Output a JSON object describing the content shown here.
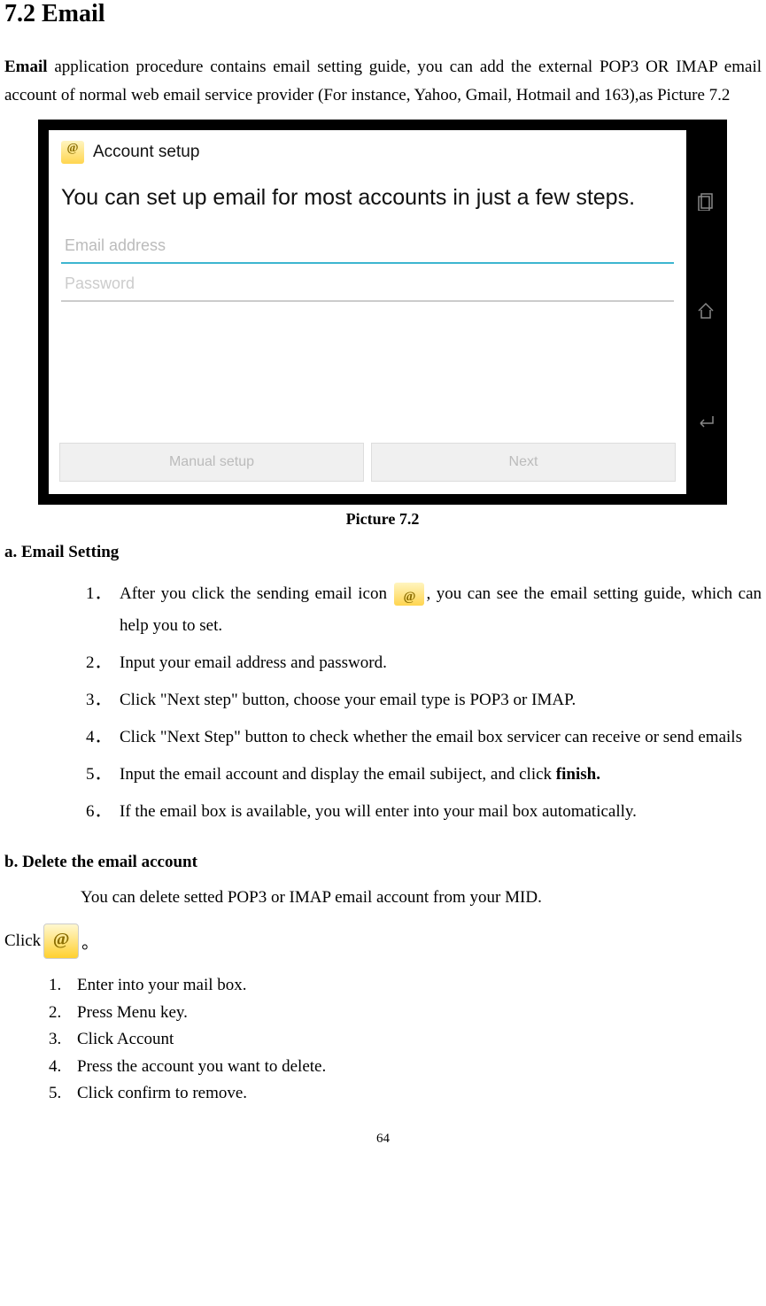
{
  "heading": "7.2 Email",
  "intro": {
    "bold_start": "Email",
    "rest": " application procedure contains email setting guide, you can add the external POP3 OR IMAP email account of normal web email service provider (For instance, Yahoo, Gmail, Hotmail and 163),as Picture 7.2"
  },
  "screenshot": {
    "header_title": "Account setup",
    "main_heading": "You can set up email for most accounts in just a few steps.",
    "email_placeholder": "Email address",
    "password_placeholder": "Password",
    "btn_manual": "Manual setup",
    "btn_next": "Next"
  },
  "caption": "Picture 7.2",
  "section_a_heading": "a. Email Setting",
  "steps_a": [
    {
      "num": "1．",
      "pre": "After you click the sending email icon ",
      "post": ", you can see the email setting guide, which can help you to set."
    },
    {
      "num": "2．",
      "text": "Input your email address and password."
    },
    {
      "num": "3．",
      "text": "Click \"Next step\" button, choose your email type is POP3 or IMAP."
    },
    {
      "num": "4．",
      "text": "Click \"Next Step\" button to check whether the email box servicer can receive or send emails"
    },
    {
      "num": "5．",
      "text_pre": "Input the email account and display the email subiject, and click ",
      "text_bold": "finish."
    },
    {
      "num": "6．",
      "text": "If the email box is available, you will enter into your mail box automatically."
    }
  ],
  "section_b_heading": "b. Delete the email account",
  "section_b_intro": "You can delete setted POP3 or IMAP email account from your MID.",
  "click_text": "Click",
  "click_after": "。",
  "steps_b": [
    {
      "num": "1.",
      "text": "Enter into your mail box."
    },
    {
      "num": "2.",
      "text": "Press Menu key."
    },
    {
      "num": "3.",
      "text": "Click Account"
    },
    {
      "num": "4.",
      "text": "Press the account you want to delete."
    },
    {
      "num": "5.",
      "text": "Click confirm to remove."
    }
  ],
  "page_number": "64"
}
